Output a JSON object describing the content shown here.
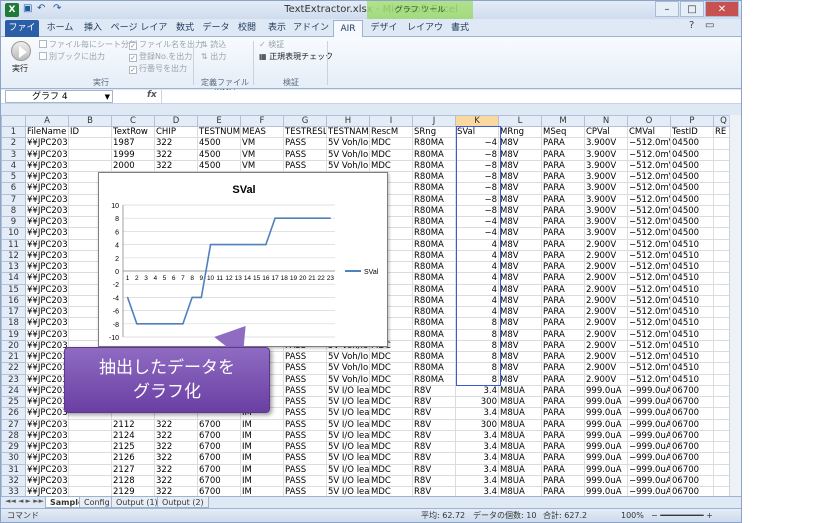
{
  "window": {
    "title": "TextExtractor.xlsx - Microsoft Excel",
    "tools_band": "グラフ ツール"
  },
  "tabs": [
    "ファイル",
    "ホーム",
    "挿入",
    "ページ レイアウト",
    "数式",
    "データ",
    "校閲",
    "表示",
    "アドイン",
    "AIR",
    "デザイン",
    "レイアウト",
    "書式"
  ],
  "ribbon": {
    "run": "実行",
    "opts": [
      "ファイル毎にシート分割",
      "別ブックに出力",
      "ファイル名を出力",
      "登録No.を出力",
      "行番号を出力"
    ],
    "load": "読込",
    "output": "出力",
    "verify": "検証",
    "regex": "正規表現チェック",
    "group_run": "実行",
    "group_def": "定義ファイル(XML)",
    "group_verify": "検証"
  },
  "namebox": "グラフ 4",
  "fx": "fx",
  "columns": [
    "A",
    "B",
    "C",
    "D",
    "E",
    "F",
    "G",
    "H",
    "I",
    "J",
    "K",
    "L",
    "M",
    "N",
    "O",
    "P",
    "Q"
  ],
  "rows": [
    [
      "FileName",
      "ID",
      "TextRow",
      "CHIP",
      "TESTNUM",
      "MEAS",
      "TESTRESL",
      "TESTNAME",
      "RescM",
      "SRng",
      "SVal",
      "MRng",
      "MSeq",
      "CPVal",
      "CMVal",
      "TestID",
      "RE"
    ],
    [
      "¥¥JPC203:5",
      "",
      "1987",
      "322",
      "4500",
      "VM",
      "PASS",
      "5V Voh/Iol",
      "MDC",
      "R80MA",
      "−4",
      "M8V",
      "PARA",
      "3.900V",
      "−512.0mV",
      "04500",
      ""
    ],
    [
      "¥¥JPC203:5",
      "",
      "1999",
      "322",
      "4500",
      "VM",
      "PASS",
      "5V Voh/Iol",
      "MDC",
      "R80MA",
      "−8",
      "M8V",
      "PARA",
      "3.900V",
      "−512.0mV",
      "04500",
      ""
    ],
    [
      "¥¥JPC203:5",
      "",
      "2000",
      "322",
      "4500",
      "VM",
      "PASS",
      "5V Voh/Iol",
      "MDC",
      "R80MA",
      "−8",
      "M8V",
      "PARA",
      "3.900V",
      "−512.0mV",
      "04500",
      ""
    ],
    [
      "¥¥JPC203:5",
      "",
      "",
      "",
      "",
      "",
      "",
      "",
      "",
      "R80MA",
      "−8",
      "M8V",
      "PARA",
      "3.900V",
      "−512.0mV",
      "04500",
      ""
    ],
    [
      "¥¥JPC203:5",
      "",
      "",
      "",
      "",
      "",
      "",
      "",
      "",
      "R80MA",
      "−8",
      "M8V",
      "PARA",
      "3.900V",
      "−512.0mV",
      "04500",
      ""
    ],
    [
      "¥¥JPC203:5",
      "",
      "",
      "",
      "",
      "",
      "",
      "",
      "",
      "R80MA",
      "−8",
      "M8V",
      "PARA",
      "3.900V",
      "−512.0mV",
      "04500",
      ""
    ],
    [
      "¥¥JPC203:5",
      "",
      "",
      "",
      "",
      "",
      "",
      "",
      "",
      "R80MA",
      "−8",
      "M8V",
      "PARA",
      "3.900V",
      "−512.0mV",
      "04500",
      ""
    ],
    [
      "¥¥JPC203:5",
      "",
      "",
      "",
      "",
      "",
      "",
      "",
      "",
      "R80MA",
      "−4",
      "M8V",
      "PARA",
      "3.900V",
      "−512.0mV",
      "04500",
      ""
    ],
    [
      "¥¥JPC203:5",
      "",
      "",
      "",
      "",
      "",
      "",
      "",
      "",
      "R80MA",
      "−4",
      "M8V",
      "PARA",
      "3.900V",
      "−512.0mV",
      "04500",
      ""
    ],
    [
      "¥¥JPC203:5",
      "",
      "",
      "",
      "",
      "",
      "",
      "",
      "",
      "R80MA",
      "4",
      "M8V",
      "PARA",
      "2.900V",
      "−512.0mV",
      "04510",
      ""
    ],
    [
      "¥¥JPC203:5",
      "",
      "",
      "",
      "",
      "",
      "",
      "",
      "",
      "R80MA",
      "4",
      "M8V",
      "PARA",
      "2.900V",
      "−512.0mV",
      "04510",
      ""
    ],
    [
      "¥¥JPC203:5",
      "",
      "",
      "",
      "",
      "",
      "",
      "",
      "",
      "R80MA",
      "4",
      "M8V",
      "PARA",
      "2.900V",
      "−512.0mV",
      "04510",
      ""
    ],
    [
      "¥¥JPC203:5",
      "",
      "",
      "",
      "",
      "",
      "",
      "",
      "",
      "R80MA",
      "4",
      "M8V",
      "PARA",
      "2.900V",
      "−512.0mV",
      "04510",
      ""
    ],
    [
      "¥¥JPC203:5",
      "",
      "",
      "",
      "",
      "",
      "",
      "",
      "",
      "R80MA",
      "4",
      "M8V",
      "PARA",
      "2.900V",
      "−512.0mV",
      "04510",
      ""
    ],
    [
      "¥¥JPC203:5",
      "",
      "",
      "",
      "",
      "",
      "",
      "",
      "",
      "R80MA",
      "4",
      "M8V",
      "PARA",
      "2.900V",
      "−512.0mV",
      "04510",
      ""
    ],
    [
      "¥¥JPC203:5",
      "",
      "",
      "",
      "",
      "",
      "",
      "",
      "",
      "R80MA",
      "4",
      "M8V",
      "PARA",
      "2.900V",
      "−512.0mV",
      "04510",
      ""
    ],
    [
      "¥¥JPC203:5",
      "",
      "",
      "",
      "",
      "",
      "",
      "",
      "",
      "R80MA",
      "8",
      "M8V",
      "PARA",
      "2.900V",
      "−512.0mV",
      "04510",
      ""
    ],
    [
      "¥¥JPC203:5",
      "",
      "",
      "",
      "",
      "",
      "",
      "",
      "",
      "R80MA",
      "8",
      "M8V",
      "PARA",
      "2.900V",
      "−512.0mV",
      "04510",
      ""
    ],
    [
      "¥¥JPC203:5",
      "",
      "2051",
      "322",
      "",
      "VM",
      "PASS",
      "5V Voh/Iol",
      "MDC",
      "R80MA",
      "8",
      "M8V",
      "PARA",
      "2.900V",
      "−512.0mV",
      "04510",
      ""
    ],
    [
      "¥¥JPC203:5",
      "",
      "",
      "",
      "",
      "VM",
      "PASS",
      "5V Voh/Iol",
      "MDC",
      "R80MA",
      "8",
      "M8V",
      "PARA",
      "2.900V",
      "−512.0mV",
      "04510",
      ""
    ],
    [
      "¥¥JPC203:5",
      "",
      "",
      "",
      "",
      "VM",
      "PASS",
      "5V Voh/Iol",
      "MDC",
      "R80MA",
      "8",
      "M8V",
      "PARA",
      "2.900V",
      "−512.0mV",
      "04510",
      ""
    ],
    [
      "¥¥JPC203:5",
      "",
      "",
      "",
      "",
      "VM",
      "PASS",
      "5V Voh/Iol",
      "MDC",
      "R80MA",
      "8",
      "M8V",
      "PARA",
      "2.900V",
      "−512.0mV",
      "04510",
      ""
    ],
    [
      "¥¥JPC203:5",
      "",
      "",
      "",
      "",
      "IM",
      "PASS",
      "5V I/O lea",
      "MDC",
      "R8V",
      "3.4",
      "M8UA",
      "PARA",
      "999.0uA",
      "−999.0uA",
      "06700",
      ""
    ],
    [
      "¥¥JPC203:5",
      "",
      "",
      "",
      "",
      "IM",
      "PASS",
      "5V I/O lea",
      "MDC",
      "R8V",
      "300",
      "M8UA",
      "PARA",
      "999.0uA",
      "−999.0uA",
      "06700",
      ""
    ],
    [
      "¥¥JPC203:5",
      "",
      "",
      "",
      "",
      "IM",
      "PASS",
      "5V I/O lea",
      "MDC",
      "R8V",
      "3.4",
      "M8UA",
      "PARA",
      "999.0uA",
      "−999.0uA",
      "06700",
      ""
    ],
    [
      "¥¥JPC203:5",
      "",
      "2112",
      "322",
      "6700",
      "IM",
      "PASS",
      "5V I/O lea",
      "MDC",
      "R8V",
      "300",
      "M8UA",
      "PARA",
      "999.0uA",
      "−999.0uA",
      "06700",
      ""
    ],
    [
      "¥¥JPC203:5",
      "",
      "2124",
      "322",
      "6700",
      "IM",
      "PASS",
      "5V I/O lea",
      "MDC",
      "R8V",
      "3.4",
      "M8UA",
      "PARA",
      "999.0uA",
      "−999.0uA",
      "06700",
      ""
    ],
    [
      "¥¥JPC203:5",
      "",
      "2125",
      "322",
      "6700",
      "IM",
      "PASS",
      "5V I/O lea",
      "MDC",
      "R8V",
      "3.4",
      "M8UA",
      "PARA",
      "999.0uA",
      "−999.0uA",
      "06700",
      ""
    ],
    [
      "¥¥JPC203:5",
      "",
      "2126",
      "322",
      "6700",
      "IM",
      "PASS",
      "5V I/O lea",
      "MDC",
      "R8V",
      "3.4",
      "M8UA",
      "PARA",
      "999.0uA",
      "−999.0uA",
      "06700",
      ""
    ],
    [
      "¥¥JPC203:5",
      "",
      "2127",
      "322",
      "6700",
      "IM",
      "PASS",
      "5V I/O lea",
      "MDC",
      "R8V",
      "3.4",
      "M8UA",
      "PARA",
      "999.0uA",
      "−999.0uA",
      "06700",
      ""
    ],
    [
      "¥¥JPC203:5",
      "",
      "2128",
      "322",
      "6700",
      "IM",
      "PASS",
      "5V I/O lea",
      "MDC",
      "R8V",
      "3.4",
      "M8UA",
      "PARA",
      "999.0uA",
      "−999.0uA",
      "06700",
      ""
    ],
    [
      "¥¥JPC203:5",
      "",
      "2129",
      "322",
      "6700",
      "IM",
      "PASS",
      "5V I/O lea",
      "MDC",
      "R8V",
      "3.4",
      "M8UA",
      "PARA",
      "999.0uA",
      "−999.0uA",
      "06700",
      ""
    ]
  ],
  "chart_data": {
    "type": "line",
    "title": "SVal",
    "x": [
      1,
      2,
      3,
      4,
      5,
      6,
      7,
      8,
      9,
      10,
      11,
      12,
      13,
      14,
      15,
      16,
      17,
      18,
      19,
      20,
      21,
      22,
      23
    ],
    "series": [
      {
        "name": "SVal",
        "values": [
          -4,
          -8,
          -8,
          -8,
          -8,
          -8,
          -8,
          -4,
          -4,
          4,
          4,
          4,
          4,
          4,
          4,
          4,
          8,
          8,
          8,
          8,
          8,
          8,
          8
        ],
        "color": "#4f81bd"
      }
    ],
    "ylim": [
      -10,
      10
    ],
    "yticks": [
      -10,
      -8,
      -6,
      -4,
      -2,
      0,
      2,
      4,
      6,
      8,
      10
    ],
    "grid": true,
    "legend": "right"
  },
  "callout": {
    "line1": "抽出したデータを",
    "line2": "グラフ化",
    "color": "#7a52b3"
  },
  "sheets": [
    "Sample",
    "Config",
    "Output (1)",
    "Output (2)"
  ],
  "status": {
    "mode": "コマンド",
    "avg": "平均: 62.72",
    "count": "データの個数: 10",
    "sum": "合計: 627.2",
    "zoom": "100%"
  }
}
